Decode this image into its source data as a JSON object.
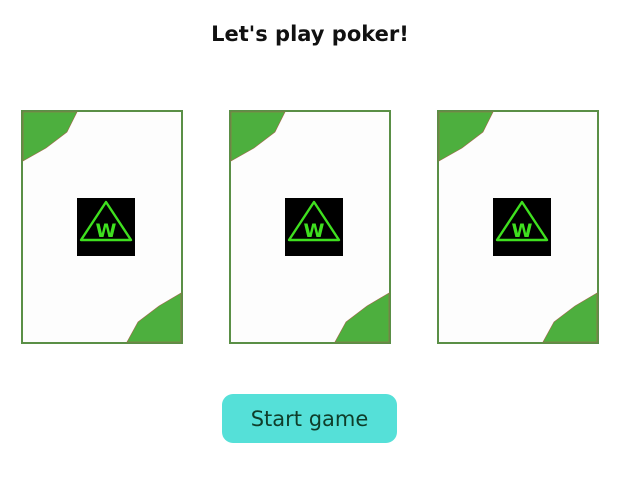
{
  "title": "Let's play poker!",
  "cards": [
    {
      "state": "face-down",
      "emblem_letter": "W"
    },
    {
      "state": "face-down",
      "emblem_letter": "W"
    },
    {
      "state": "face-down",
      "emblem_letter": "W"
    }
  ],
  "start_button": {
    "label": "Start game"
  },
  "colors": {
    "card_border": "#5a8f46",
    "card_corner": "#4daf3e",
    "card_face": "#fdfdfd",
    "emblem_bg": "#000000",
    "emblem_line": "#3fe01f",
    "button_bg": "#55e0d8",
    "button_text": "#0f3d2a"
  },
  "icons": {
    "card_emblem": "triangle-w-logo-icon"
  }
}
